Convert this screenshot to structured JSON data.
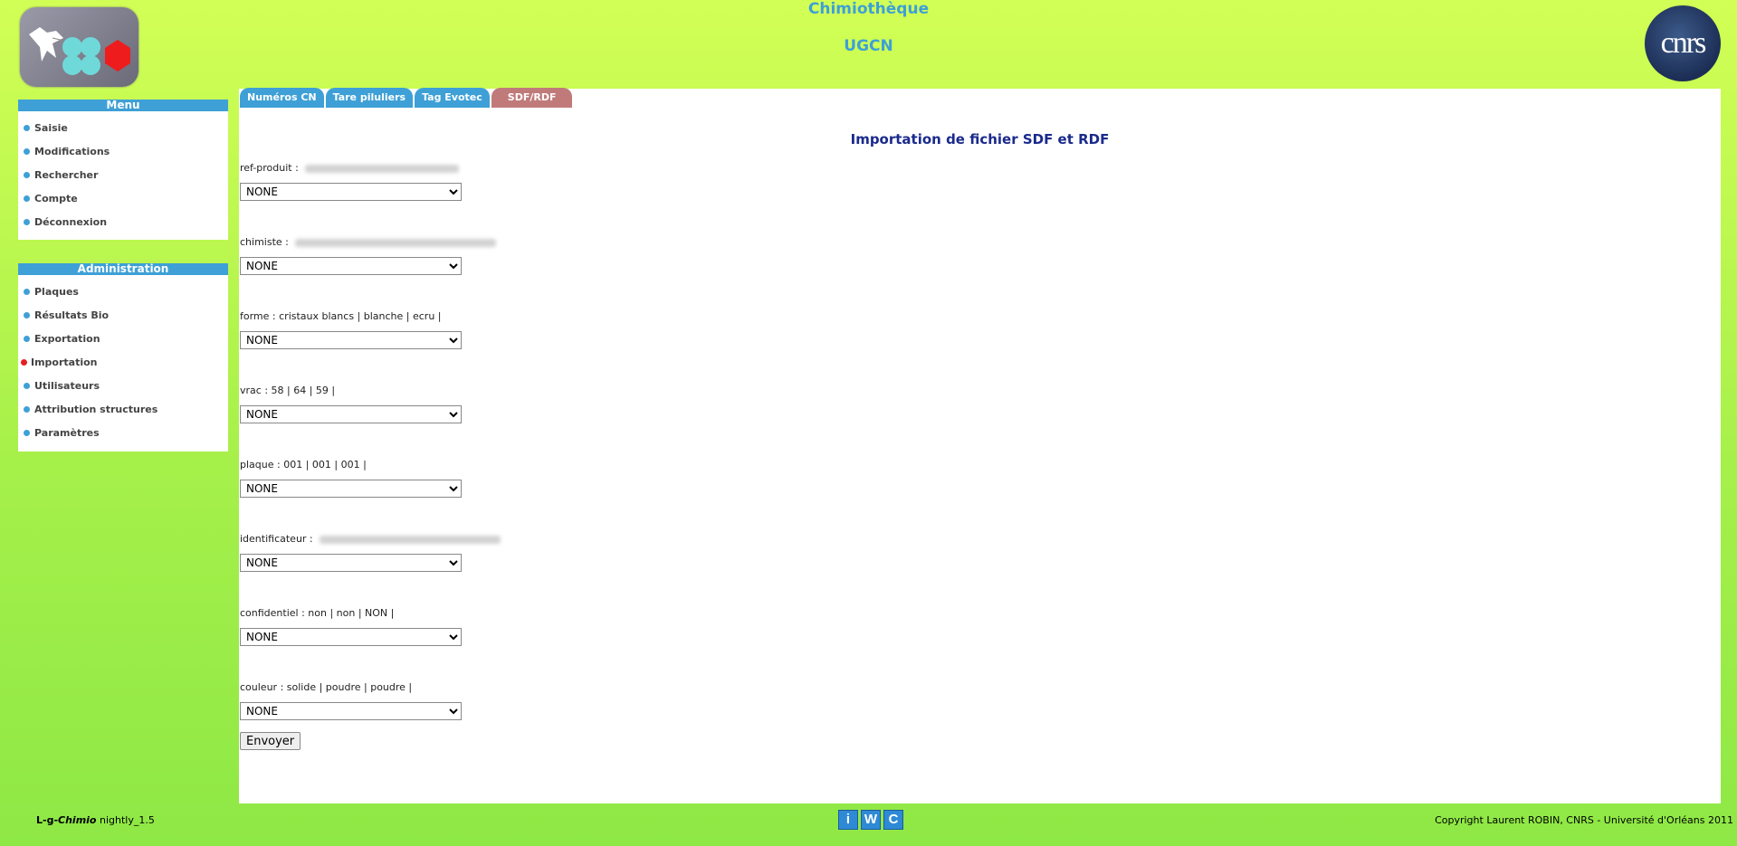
{
  "header": {
    "title": "Chimiothèque",
    "subtitle": "UGCN",
    "cnrs_logo_text": "cnrs"
  },
  "menu": {
    "title": "Menu",
    "items": [
      "Saisie",
      "Modifications",
      "Rechercher",
      "Compte",
      "Déconnexion"
    ]
  },
  "admin": {
    "title": "Administration",
    "items": [
      "Plaques",
      "Résultats Bio",
      "Exportation",
      "Importation",
      "Utilisateurs",
      "Attribution structures",
      "Paramètres"
    ],
    "active": "Importation"
  },
  "tabs": [
    "Numéros CN",
    "Tare piluliers",
    "Tag Evotec",
    "SDF/RDF"
  ],
  "active_tab": "SDF/RDF",
  "form": {
    "title": "Importation de fichier SDF et RDF",
    "fields": [
      {
        "label": "ref-produit :",
        "values": ""
      },
      {
        "label": "chimiste :",
        "values": ""
      },
      {
        "label": "forme :",
        "values": "cristaux blancs | blanche | ecru |"
      },
      {
        "label": "vrac :",
        "values": "58 | 64 | 59 |"
      },
      {
        "label": "plaque :",
        "values": "001 | 001 | 001 |"
      },
      {
        "label": "identificateur :",
        "values": ""
      },
      {
        "label": "confidentiel :",
        "values": "non | non | NON |"
      },
      {
        "label": "couleur :",
        "values": "solide | poudre | poudre |"
      }
    ],
    "select_value": "NONE",
    "submit_label": "Envoyer"
  },
  "footer": {
    "app_prefix": "L-g-",
    "app_italic": "Chimio",
    "version": "nightly_1.5",
    "icons": [
      "i",
      "W",
      "C"
    ],
    "copyright": "Copyright Laurent ROBIN, CNRS - Université d'Orléans 2011"
  },
  "colors": {
    "accent": "#3ea0d6",
    "active_tab": "#c07a7a",
    "active_dot": "#e62020",
    "title": "#1a2a8c"
  }
}
